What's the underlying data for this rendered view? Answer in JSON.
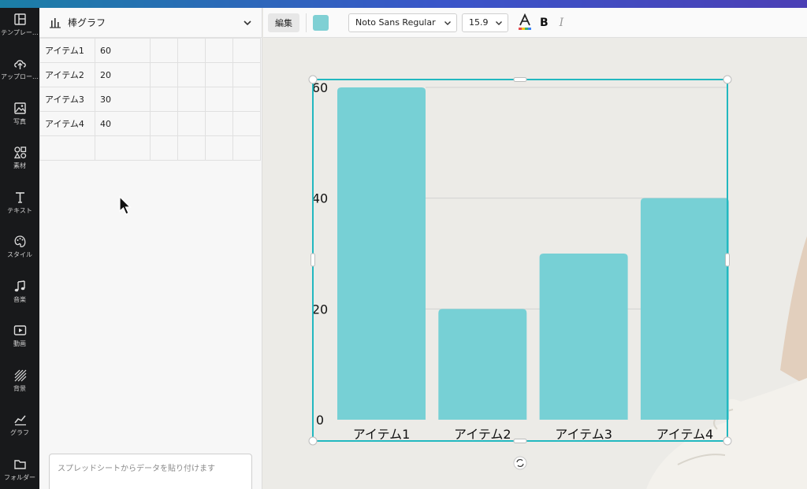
{
  "rail": [
    {
      "label": "テンプレー…",
      "icon": "template-icon"
    },
    {
      "label": "アップロー…",
      "icon": "upload-cloud-icon"
    },
    {
      "label": "写真",
      "icon": "photo-icon"
    },
    {
      "label": "素材",
      "icon": "elements-icon"
    },
    {
      "label": "テキスト",
      "icon": "text-icon"
    },
    {
      "label": "スタイル",
      "icon": "palette-icon"
    },
    {
      "label": "音楽",
      "icon": "music-icon"
    },
    {
      "label": "動画",
      "icon": "video-icon"
    },
    {
      "label": "背景",
      "icon": "background-icon"
    },
    {
      "label": "グラフ",
      "icon": "chart-icon"
    },
    {
      "label": "フォルダー",
      "icon": "folder-icon"
    }
  ],
  "panel": {
    "chart_type": "棒グラフ",
    "rows": [
      [
        "アイテム1",
        "60",
        "",
        "",
        "",
        ""
      ],
      [
        "アイテム2",
        "20",
        "",
        "",
        "",
        ""
      ],
      [
        "アイテム3",
        "30",
        "",
        "",
        "",
        ""
      ],
      [
        "アイテム4",
        "40",
        "",
        "",
        "",
        ""
      ],
      [
        "",
        "",
        "",
        "",
        "",
        ""
      ]
    ],
    "paste_placeholder": "スプレッドシートからデータを貼り付けます"
  },
  "toolbar": {
    "edit_label": "編集",
    "bar_color": "#7fd0d4",
    "font": "Noto Sans Regular",
    "font_size": "15.9",
    "bold_label": "B",
    "italic_label": "I"
  },
  "colors": {
    "bar": "#77d0d5",
    "selection": "#22b8c0",
    "grid": "#d2d2d2"
  },
  "chart_data": {
    "type": "bar",
    "categories": [
      "アイテム1",
      "アイテム2",
      "アイテム3",
      "アイテム4"
    ],
    "values": [
      60,
      20,
      30,
      40
    ],
    "yticks": [
      "0",
      "20",
      "40",
      "60"
    ],
    "ylim": [
      0,
      60
    ],
    "grid": true,
    "title": "",
    "xlabel": "",
    "ylabel": ""
  }
}
